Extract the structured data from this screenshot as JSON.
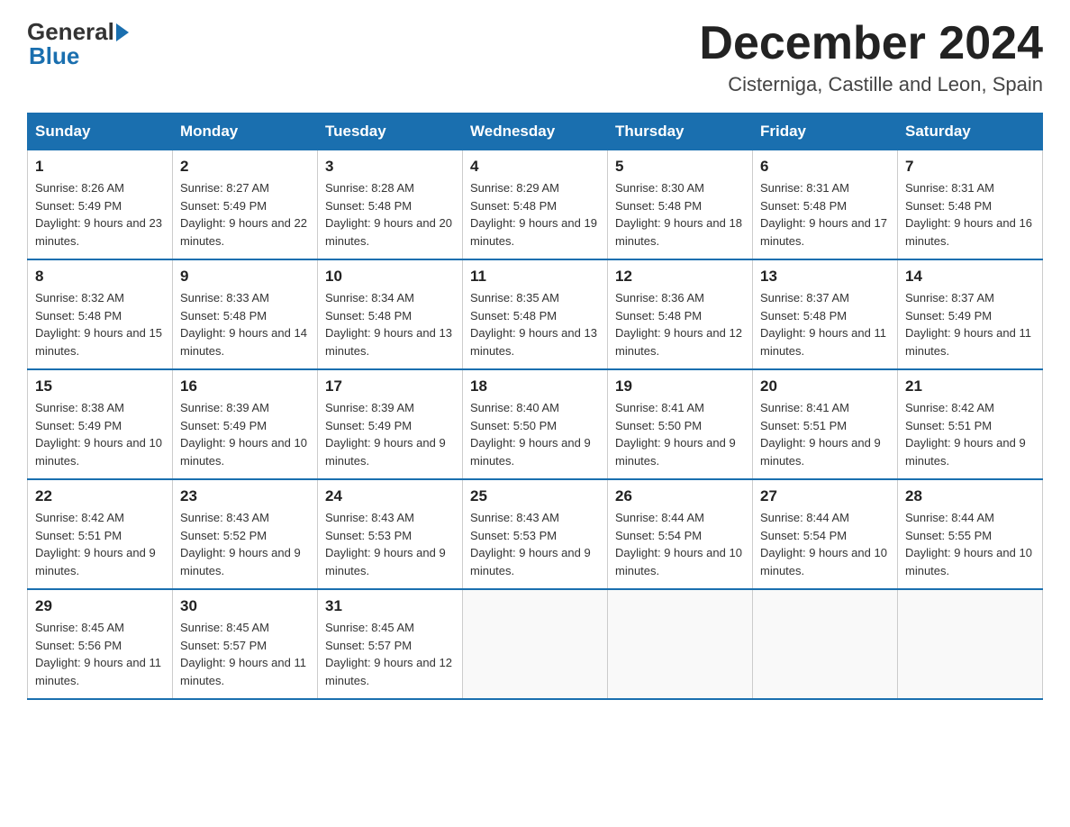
{
  "header": {
    "logo": {
      "general": "General",
      "blue": "Blue"
    },
    "title": "December 2024",
    "location": "Cisterniga, Castille and Leon, Spain"
  },
  "days_of_week": [
    "Sunday",
    "Monday",
    "Tuesday",
    "Wednesday",
    "Thursday",
    "Friday",
    "Saturday"
  ],
  "weeks": [
    [
      {
        "day": "1",
        "sunrise": "Sunrise: 8:26 AM",
        "sunset": "Sunset: 5:49 PM",
        "daylight": "Daylight: 9 hours and 23 minutes."
      },
      {
        "day": "2",
        "sunrise": "Sunrise: 8:27 AM",
        "sunset": "Sunset: 5:49 PM",
        "daylight": "Daylight: 9 hours and 22 minutes."
      },
      {
        "day": "3",
        "sunrise": "Sunrise: 8:28 AM",
        "sunset": "Sunset: 5:48 PM",
        "daylight": "Daylight: 9 hours and 20 minutes."
      },
      {
        "day": "4",
        "sunrise": "Sunrise: 8:29 AM",
        "sunset": "Sunset: 5:48 PM",
        "daylight": "Daylight: 9 hours and 19 minutes."
      },
      {
        "day": "5",
        "sunrise": "Sunrise: 8:30 AM",
        "sunset": "Sunset: 5:48 PM",
        "daylight": "Daylight: 9 hours and 18 minutes."
      },
      {
        "day": "6",
        "sunrise": "Sunrise: 8:31 AM",
        "sunset": "Sunset: 5:48 PM",
        "daylight": "Daylight: 9 hours and 17 minutes."
      },
      {
        "day": "7",
        "sunrise": "Sunrise: 8:31 AM",
        "sunset": "Sunset: 5:48 PM",
        "daylight": "Daylight: 9 hours and 16 minutes."
      }
    ],
    [
      {
        "day": "8",
        "sunrise": "Sunrise: 8:32 AM",
        "sunset": "Sunset: 5:48 PM",
        "daylight": "Daylight: 9 hours and 15 minutes."
      },
      {
        "day": "9",
        "sunrise": "Sunrise: 8:33 AM",
        "sunset": "Sunset: 5:48 PM",
        "daylight": "Daylight: 9 hours and 14 minutes."
      },
      {
        "day": "10",
        "sunrise": "Sunrise: 8:34 AM",
        "sunset": "Sunset: 5:48 PM",
        "daylight": "Daylight: 9 hours and 13 minutes."
      },
      {
        "day": "11",
        "sunrise": "Sunrise: 8:35 AM",
        "sunset": "Sunset: 5:48 PM",
        "daylight": "Daylight: 9 hours and 13 minutes."
      },
      {
        "day": "12",
        "sunrise": "Sunrise: 8:36 AM",
        "sunset": "Sunset: 5:48 PM",
        "daylight": "Daylight: 9 hours and 12 minutes."
      },
      {
        "day": "13",
        "sunrise": "Sunrise: 8:37 AM",
        "sunset": "Sunset: 5:48 PM",
        "daylight": "Daylight: 9 hours and 11 minutes."
      },
      {
        "day": "14",
        "sunrise": "Sunrise: 8:37 AM",
        "sunset": "Sunset: 5:49 PM",
        "daylight": "Daylight: 9 hours and 11 minutes."
      }
    ],
    [
      {
        "day": "15",
        "sunrise": "Sunrise: 8:38 AM",
        "sunset": "Sunset: 5:49 PM",
        "daylight": "Daylight: 9 hours and 10 minutes."
      },
      {
        "day": "16",
        "sunrise": "Sunrise: 8:39 AM",
        "sunset": "Sunset: 5:49 PM",
        "daylight": "Daylight: 9 hours and 10 minutes."
      },
      {
        "day": "17",
        "sunrise": "Sunrise: 8:39 AM",
        "sunset": "Sunset: 5:49 PM",
        "daylight": "Daylight: 9 hours and 9 minutes."
      },
      {
        "day": "18",
        "sunrise": "Sunrise: 8:40 AM",
        "sunset": "Sunset: 5:50 PM",
        "daylight": "Daylight: 9 hours and 9 minutes."
      },
      {
        "day": "19",
        "sunrise": "Sunrise: 8:41 AM",
        "sunset": "Sunset: 5:50 PM",
        "daylight": "Daylight: 9 hours and 9 minutes."
      },
      {
        "day": "20",
        "sunrise": "Sunrise: 8:41 AM",
        "sunset": "Sunset: 5:51 PM",
        "daylight": "Daylight: 9 hours and 9 minutes."
      },
      {
        "day": "21",
        "sunrise": "Sunrise: 8:42 AM",
        "sunset": "Sunset: 5:51 PM",
        "daylight": "Daylight: 9 hours and 9 minutes."
      }
    ],
    [
      {
        "day": "22",
        "sunrise": "Sunrise: 8:42 AM",
        "sunset": "Sunset: 5:51 PM",
        "daylight": "Daylight: 9 hours and 9 minutes."
      },
      {
        "day": "23",
        "sunrise": "Sunrise: 8:43 AM",
        "sunset": "Sunset: 5:52 PM",
        "daylight": "Daylight: 9 hours and 9 minutes."
      },
      {
        "day": "24",
        "sunrise": "Sunrise: 8:43 AM",
        "sunset": "Sunset: 5:53 PM",
        "daylight": "Daylight: 9 hours and 9 minutes."
      },
      {
        "day": "25",
        "sunrise": "Sunrise: 8:43 AM",
        "sunset": "Sunset: 5:53 PM",
        "daylight": "Daylight: 9 hours and 9 minutes."
      },
      {
        "day": "26",
        "sunrise": "Sunrise: 8:44 AM",
        "sunset": "Sunset: 5:54 PM",
        "daylight": "Daylight: 9 hours and 10 minutes."
      },
      {
        "day": "27",
        "sunrise": "Sunrise: 8:44 AM",
        "sunset": "Sunset: 5:54 PM",
        "daylight": "Daylight: 9 hours and 10 minutes."
      },
      {
        "day": "28",
        "sunrise": "Sunrise: 8:44 AM",
        "sunset": "Sunset: 5:55 PM",
        "daylight": "Daylight: 9 hours and 10 minutes."
      }
    ],
    [
      {
        "day": "29",
        "sunrise": "Sunrise: 8:45 AM",
        "sunset": "Sunset: 5:56 PM",
        "daylight": "Daylight: 9 hours and 11 minutes."
      },
      {
        "day": "30",
        "sunrise": "Sunrise: 8:45 AM",
        "sunset": "Sunset: 5:57 PM",
        "daylight": "Daylight: 9 hours and 11 minutes."
      },
      {
        "day": "31",
        "sunrise": "Sunrise: 8:45 AM",
        "sunset": "Sunset: 5:57 PM",
        "daylight": "Daylight: 9 hours and 12 minutes."
      },
      null,
      null,
      null,
      null
    ]
  ]
}
